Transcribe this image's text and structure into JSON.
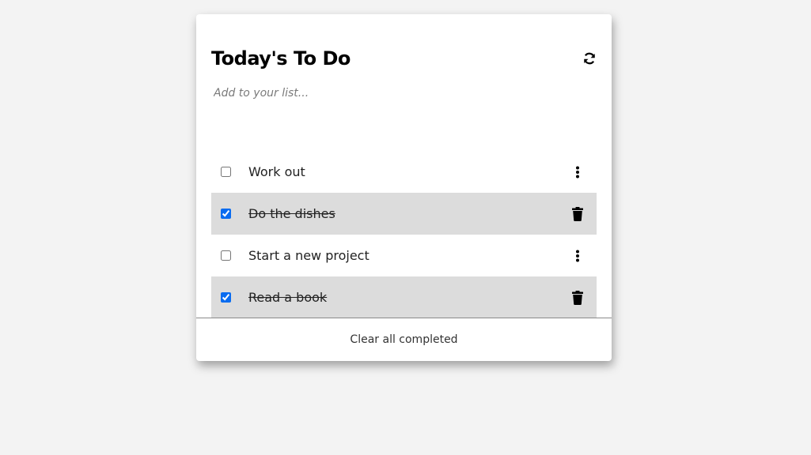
{
  "app": {
    "title": "Today's To Do",
    "refresh_icon": "refresh-icon"
  },
  "add_input": {
    "placeholder": "Add to your list...",
    "value": ""
  },
  "todos": [
    {
      "label": "Work out",
      "completed": false,
      "action_icon": "more-vertical-icon"
    },
    {
      "label": "Do the dishes",
      "completed": true,
      "action_icon": "trash-icon"
    },
    {
      "label": "Start a new project",
      "completed": false,
      "action_icon": "more-vertical-icon"
    },
    {
      "label": "Read a book",
      "completed": true,
      "action_icon": "trash-icon"
    }
  ],
  "footer": {
    "clear_label": "Clear all completed"
  },
  "colors": {
    "background": "#f3f3f3",
    "card": "#ffffff",
    "completed_row": "#dcdcdc",
    "checkbox_accent": "#0a6cf0"
  }
}
